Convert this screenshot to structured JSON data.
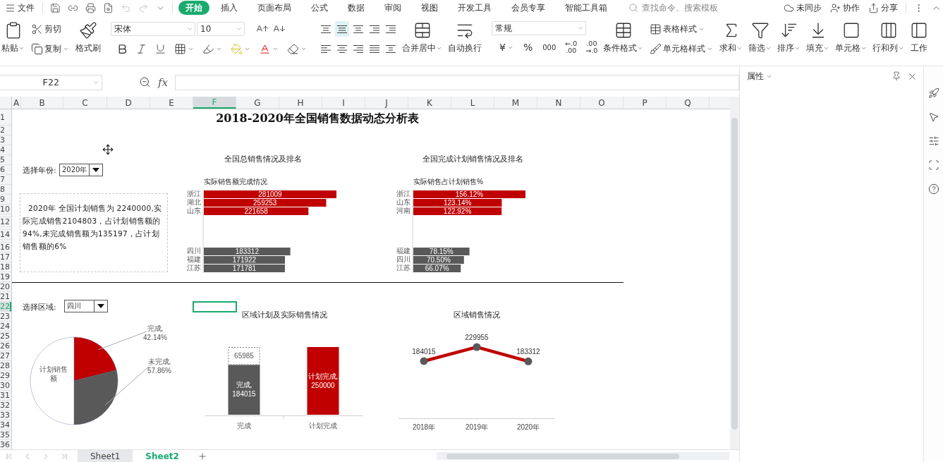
{
  "menu_bar": {
    "file": "文件",
    "tabs": [
      {
        "label": "开始",
        "selected": true
      },
      {
        "label": "插入",
        "selected": false
      },
      {
        "label": "页面布局",
        "selected": false
      },
      {
        "label": "公式",
        "selected": false
      },
      {
        "label": "数据",
        "selected": false
      },
      {
        "label": "审阅",
        "selected": false
      },
      {
        "label": "视图",
        "selected": false
      },
      {
        "label": "开发工具",
        "selected": false
      },
      {
        "label": "会员专享",
        "selected": false
      },
      {
        "label": "智能工具箱",
        "selected": false
      }
    ],
    "search": {
      "placeholder": "查找命令、搜索模板"
    },
    "sync": "未同步",
    "collab": "协作",
    "share": "分享"
  },
  "ribbon": {
    "paste": {
      "label": "粘贴",
      "menu": true
    },
    "cut": {
      "label": "剪切",
      "menu": false
    },
    "copy": {
      "label": "复制",
      "menu": true
    },
    "painter": {
      "label": "格式刷",
      "menu": false
    },
    "font": "宋体",
    "font_size": "10",
    "align": [
      {
        "selected": false
      },
      {
        "selected": true
      },
      {
        "selected": false
      },
      {
        "selected": false
      },
      {
        "selected": false
      },
      {
        "selected": false
      },
      {
        "selected": false
      },
      {
        "selected": false
      },
      {
        "selected": false
      },
      {
        "selected": false
      }
    ],
    "merge": {
      "label": "合并居中",
      "menu": true
    },
    "wrap": {
      "label": "自动换行",
      "menu": false
    },
    "number_format": "常规",
    "currency": {
      "text": "¥",
      "menu": true
    },
    "percent": "%",
    "thousands": "000",
    "add_decimal": [
      "←.0",
      ".00"
    ],
    "remove_decimal": [
      ".00",
      "→.0"
    ],
    "conditional": {
      "label": "条件格式",
      "menu": true
    },
    "table_style": {
      "label": "表格样式",
      "menu": true
    },
    "cell_style": {
      "label": "单元格样式",
      "menu": true
    },
    "tools": [
      {
        "label": "求和",
        "menu": true
      },
      {
        "label": "筛选",
        "menu": true
      },
      {
        "label": "排序",
        "menu": true
      },
      {
        "label": "填充",
        "menu": true
      },
      {
        "label": "单元格",
        "menu": true
      },
      {
        "label": "行和列",
        "menu": true
      },
      {
        "label": "工作",
        "menu": false
      }
    ]
  },
  "formula_bar": {
    "name_box": "F22",
    "fx": "fx"
  },
  "sheet": {
    "columns": [
      {
        "label": "A",
        "selected": false
      },
      {
        "label": "B",
        "selected": false
      },
      {
        "label": "C",
        "selected": false
      },
      {
        "label": "D",
        "selected": false
      },
      {
        "label": "E",
        "selected": false
      },
      {
        "label": "F",
        "selected": true
      },
      {
        "label": "G",
        "selected": false
      },
      {
        "label": "H",
        "selected": false
      },
      {
        "label": "I",
        "selected": false
      },
      {
        "label": "J",
        "selected": false
      },
      {
        "label": "K",
        "selected": false
      },
      {
        "label": "L",
        "selected": false
      },
      {
        "label": "M",
        "selected": false
      },
      {
        "label": "N",
        "selected": false
      },
      {
        "label": "O",
        "selected": false
      },
      {
        "label": "P",
        "selected": false
      },
      {
        "label": "Q",
        "selected": false
      }
    ],
    "rows": [
      {
        "label": "1",
        "selected": false
      },
      {
        "label": "2",
        "selected": false
      },
      {
        "label": "3",
        "selected": false
      },
      {
        "label": "4",
        "selected": false
      },
      {
        "label": "5",
        "selected": false
      },
      {
        "label": "6",
        "selected": false
      },
      {
        "label": "7",
        "selected": false
      },
      {
        "label": "8",
        "selected": false
      },
      {
        "label": "9",
        "selected": false
      },
      {
        "label": "10",
        "selected": false
      },
      {
        "compact": true,
        "selected": false
      },
      {
        "label": "12",
        "selected": false
      },
      {
        "compact": true,
        "selected": false
      },
      {
        "label": "14",
        "selected": false
      },
      {
        "compact": true,
        "selected": false
      },
      {
        "label": "16",
        "selected": false
      },
      {
        "label": "17",
        "selected": false
      },
      {
        "label": "18",
        "selected": false
      },
      {
        "label": "19",
        "selected": false
      },
      {
        "label": "20",
        "selected": false
      },
      {
        "label": "21",
        "selected": false
      },
      {
        "label": "22",
        "selected": true
      },
      {
        "label": "23",
        "selected": false
      },
      {
        "label": "24",
        "selected": false
      },
      {
        "label": "25",
        "selected": false
      },
      {
        "label": "26",
        "selected": false
      },
      {
        "label": "27",
        "selected": false
      },
      {
        "label": "28",
        "selected": false
      },
      {
        "label": "29",
        "selected": false
      },
      {
        "label": "30",
        "selected": false
      },
      {
        "label": "31",
        "selected": false
      },
      {
        "label": "32",
        "selected": false
      },
      {
        "label": "33",
        "selected": false
      },
      {
        "label": "34",
        "selected": false
      },
      {
        "label": "35",
        "selected": false
      },
      {
        "label": "36",
        "selected": false
      }
    ],
    "title": "2018-2020年全国销售数据动态分析表",
    "year_picker": {
      "label": "选择年份:",
      "value": "2020年"
    },
    "summary": "2020年  全国计划销售为  2240000,实际完成销售2104803，占计划销售额的94%,未完成销售额为135197，占计划销售额的6%",
    "total_sales": {
      "title": "全国总销售情况及排名",
      "subtitle": "实际销售额完成情况",
      "chart_data": {
        "type": "bar",
        "orientation": "horizontal",
        "categories": [
          "浙江",
          "湖北",
          "山东",
          "四川",
          "福建",
          "江苏"
        ],
        "series": [
          {
            "color": "#c00000",
            "values": [
              281009,
              259253,
              221658,
              null,
              null,
              null
            ],
            "value_labels": [
              "281009",
              "259253",
              "221658",
              null,
              null,
              null
            ]
          },
          {
            "color": "#595959",
            "values": [
              null,
              null,
              null,
              183312,
              171922,
              171781
            ],
            "value_labels": [
              null,
              null,
              null,
              "183312",
              "171922",
              "171781"
            ]
          }
        ]
      }
    },
    "plan_completion": {
      "title": "全国完成计划销售情况及排名",
      "subtitle": "实际销售占计划销售%",
      "chart_data": {
        "type": "bar",
        "orientation": "horizontal",
        "categories": [
          "浙江",
          "山东",
          "河南",
          "福建",
          "四川",
          "江苏"
        ],
        "series": [
          {
            "color": "#c00000",
            "values": [
              156.12,
              123.14,
              122.92,
              null,
              null,
              null
            ],
            "value_labels": [
              "156.12%",
              "123.14%",
              "122.92%",
              null,
              null,
              null
            ]
          },
          {
            "color": "#595959",
            "values": [
              null,
              null,
              null,
              78.15,
              70.5,
              66.07
            ],
            "value_labels": [
              null,
              null,
              null,
              "78.15%",
              "70.50%",
              "66.07%"
            ]
          }
        ]
      }
    },
    "region_picker": {
      "label": "选择区域:",
      "value": "四川"
    },
    "region_pie": {
      "chart_data": {
        "type": "pie",
        "values": [
          42.14,
          57.86,
          100
        ],
        "value_labels": [
          "完成,\n42.14%",
          "未完成,\n57.86%",
          "计划销售额"
        ]
      }
    },
    "region_plan": {
      "title": "区域计划及实际销售情况",
      "chart_data": {
        "type": "bar",
        "orientation": "vertical",
        "stacked": true,
        "categories": [
          "完成",
          "计划完成"
        ],
        "series": [
          {
            "color": "#595959",
            "values": [
              184015,
              null
            ],
            "value_labels": [
              "完成,\n184015",
              null
            ]
          },
          {
            "color": "#ffffff",
            "values": [
              65985,
              null
            ],
            "value_labels": [
              "65985",
              null
            ]
          },
          {
            "color": "#c00000",
            "values": [
              null,
              250000
            ],
            "value_labels": [
              null,
              "计划完成,\n250000"
            ]
          }
        ]
      }
    },
    "region_trend": {
      "title": "区域销售情况",
      "chart_data": {
        "type": "line",
        "categories": [
          "2018年",
          "2019年",
          "2020年"
        ],
        "data_labels": true,
        "series": [
          {
            "color": "#c00000",
            "marker": true,
            "values": [
              184015,
              229955,
              183312
            ]
          }
        ]
      }
    }
  },
  "sheet_tabs": [
    {
      "label": "Sheet1",
      "selected": false
    },
    {
      "label": "Sheet2",
      "selected": true
    }
  ],
  "side_panel": {
    "title": "属性"
  }
}
